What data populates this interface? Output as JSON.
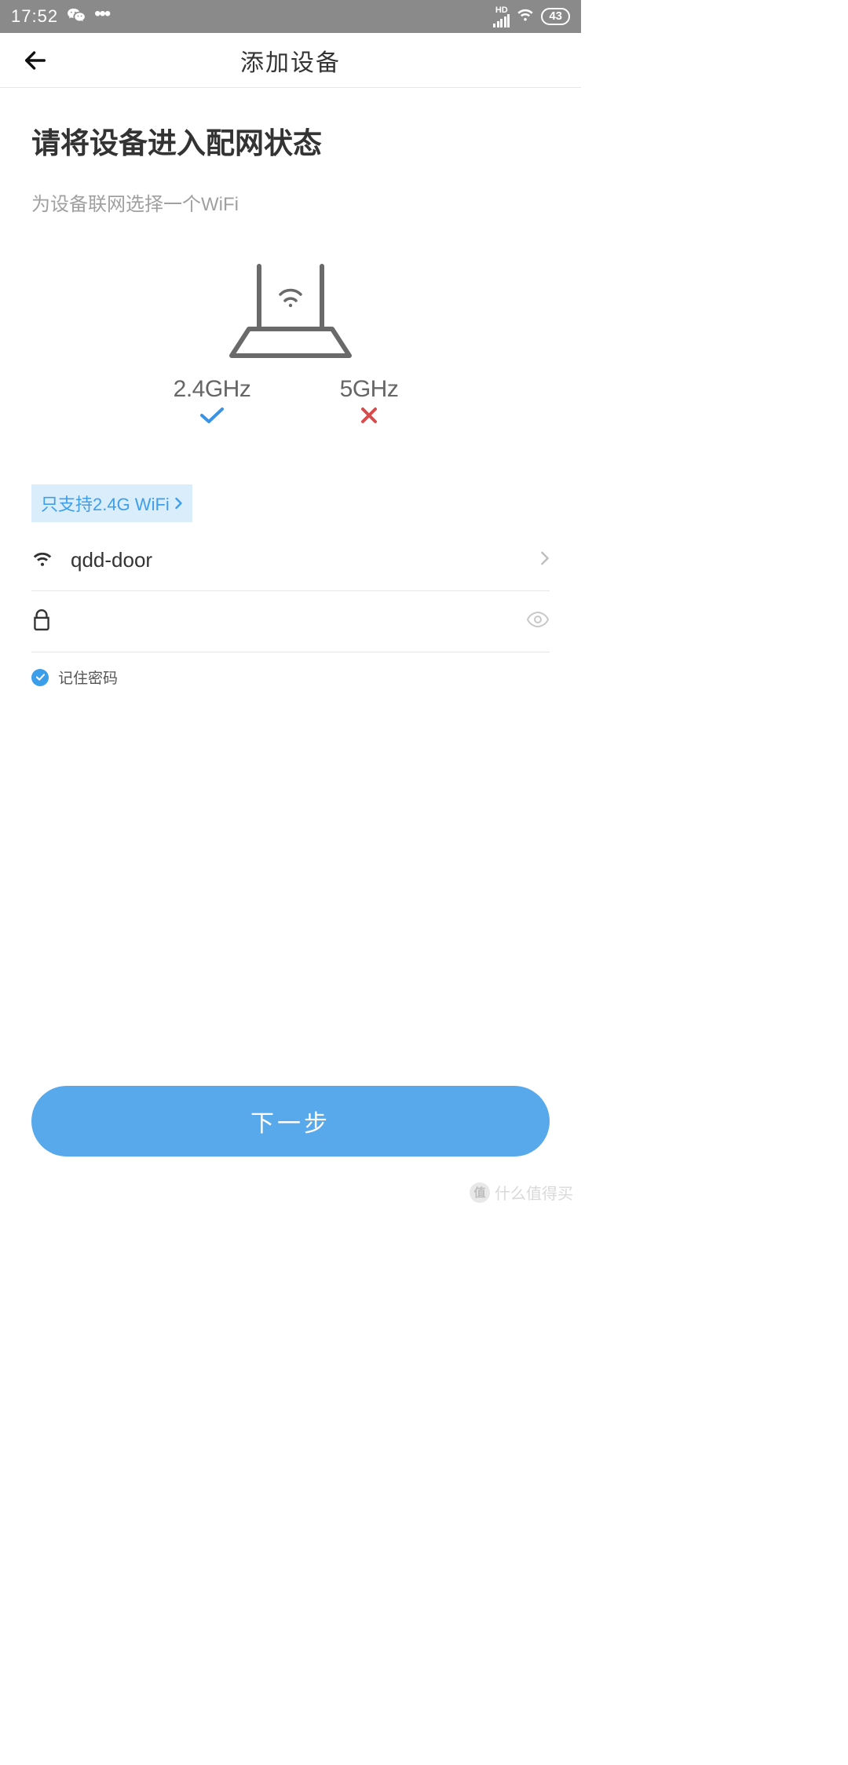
{
  "status_bar": {
    "time": "17:52",
    "battery": "43",
    "hd_label": "HD"
  },
  "header": {
    "title": "添加设备"
  },
  "content": {
    "main_heading": "请将设备进入配网状态",
    "sub_heading": "为设备联网选择一个WiFi",
    "freq_24": "2.4GHz",
    "freq_5": "5GHz",
    "support_chip": "只支持2.4G WiFi",
    "selected_wifi": "qdd-door",
    "password_value": "",
    "remember_label": "记住密码",
    "remember_checked": true,
    "next_button": "下一步"
  },
  "watermark": {
    "badge": "值",
    "text": "什么值得买"
  }
}
